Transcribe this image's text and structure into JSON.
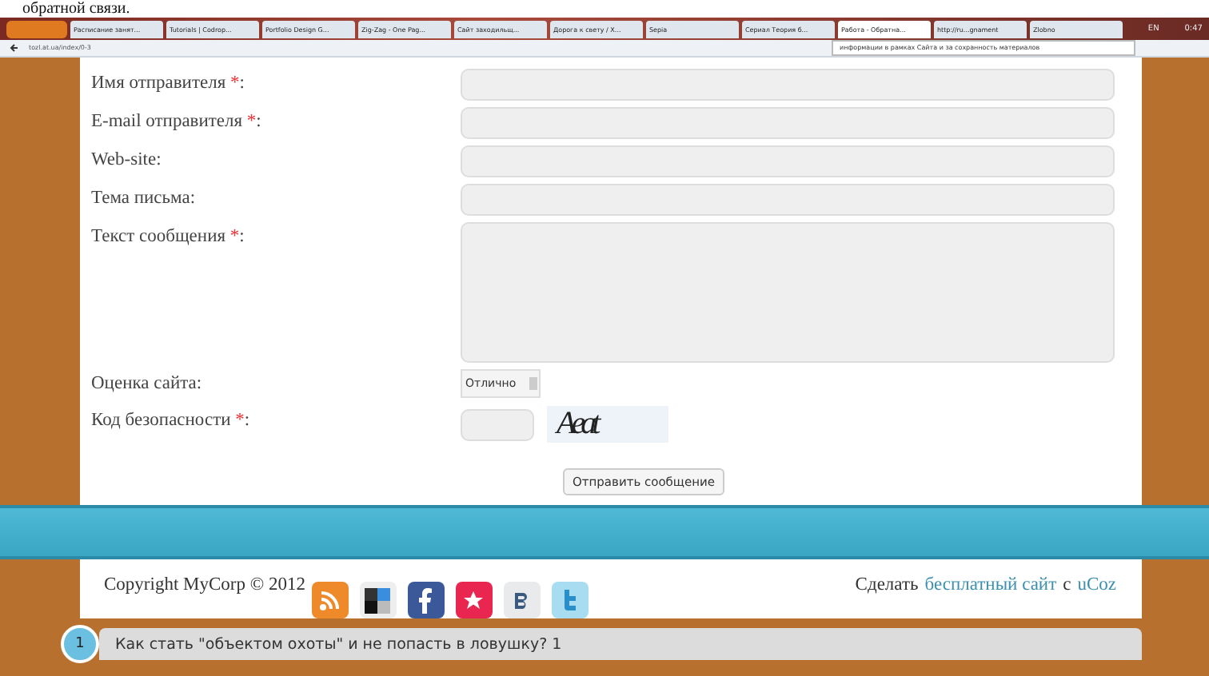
{
  "heading": "обратной связи.",
  "browser": {
    "tabs": [
      {
        "label": "Расписание занят...",
        "selected": false
      },
      {
        "label": "Tutorials | Codrop...",
        "selected": false
      },
      {
        "label": "Portfolio Design G...",
        "selected": false
      },
      {
        "label": "Zig-Zag - One Pag...",
        "selected": false
      },
      {
        "label": "Сайт заходильщ...",
        "selected": false
      },
      {
        "label": "Дорога к свету / Х...",
        "selected": false
      },
      {
        "label": "Sepia",
        "selected": false
      },
      {
        "label": "Сериал Теория б...",
        "selected": false
      },
      {
        "label": "Работа - Обратна...",
        "selected": true
      },
      {
        "label": "http://ru...gnament",
        "selected": false
      },
      {
        "label": "Zlobno",
        "selected": false
      }
    ],
    "address": "tozl.at.ua/index/0-3",
    "search": "информации в рамках Сайта и за сохранность материалов",
    "tray": {
      "language": "EN",
      "time": "0:47"
    }
  },
  "form": {
    "fields": [
      {
        "label": "Имя отправителя",
        "required": true,
        "kind": "input"
      },
      {
        "label": "E-mail отправителя",
        "required": true,
        "kind": "input"
      },
      {
        "label": "Web-site:",
        "required": false,
        "kind": "input"
      },
      {
        "label": "Тема письма:",
        "required": false,
        "kind": "input"
      },
      {
        "label": "Текст сообщения",
        "required": true,
        "kind": "textarea"
      },
      {
        "label": "Оценка сайта:",
        "required": false,
        "kind": "select",
        "value": "Отлично"
      },
      {
        "label": "Код безопасности",
        "required": true,
        "kind": "captcha",
        "captcha": "Aeat"
      }
    ],
    "required_mark": "*",
    "colon": ":",
    "submit": "Отправить сообщение"
  },
  "footer": {
    "copyright": "Copyright MyCorp © 2012",
    "make": "Сделать",
    "link": "бесплатный сайт",
    "with": "с",
    "brand": "uCoz"
  },
  "news": {
    "number": "1",
    "title": "Как стать \"объектом охоты\" и не попасть в ловушку? 1"
  }
}
